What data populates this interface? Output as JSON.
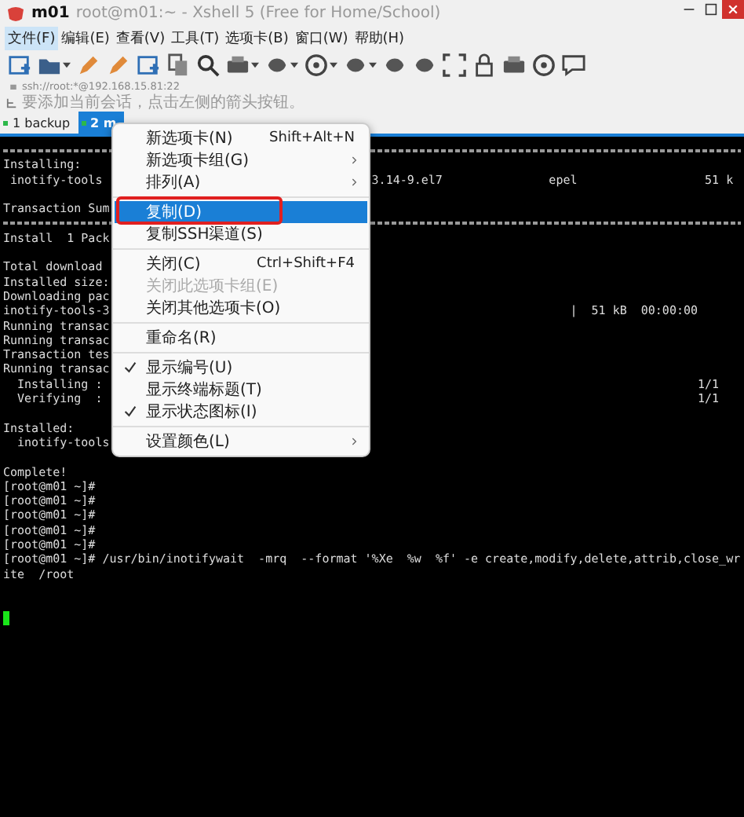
{
  "window": {
    "session": "m01",
    "title": "root@m01:~ - Xshell 5 (Free for Home/School)"
  },
  "menubar": [
    {
      "label": "文件(F)",
      "selected": true
    },
    {
      "label": "编辑(E)",
      "selected": false
    },
    {
      "label": "查看(V)",
      "selected": false
    },
    {
      "label": "工具(T)",
      "selected": false
    },
    {
      "label": "选项卡(B)",
      "selected": false
    },
    {
      "label": "窗口(W)",
      "selected": false
    },
    {
      "label": "帮助(H)",
      "selected": false
    }
  ],
  "address": "ssh://root:*@192.168.15.81:22",
  "hint": "要添加当前会话，点击左侧的箭头按钮。",
  "tabs": [
    {
      "label": "1 backup",
      "selected": false
    },
    {
      "label": "2 m",
      "selected": true
    }
  ],
  "terminal": [
    {
      "kind": "rule"
    },
    {
      "kind": "text",
      "left": "Installing:"
    },
    {
      "kind": "text",
      "left": " inotify-tools",
      "right": "3.14-9.el7               epel                  51 k"
    },
    {
      "kind": "text"
    },
    {
      "kind": "text",
      "left": "Transaction Sum"
    },
    {
      "kind": "rule"
    },
    {
      "kind": "text",
      "left": "Install  1 Pack"
    },
    {
      "kind": "text"
    },
    {
      "kind": "text",
      "left": "Total download "
    },
    {
      "kind": "text",
      "left": "Installed size:"
    },
    {
      "kind": "text",
      "left": "Downloading pac"
    },
    {
      "kind": "text",
      "left": "inotify-tools-3",
      "right": "                            |  51 kB  00:00:00"
    },
    {
      "kind": "text",
      "left": "Running transac"
    },
    {
      "kind": "text",
      "left": "Running transac"
    },
    {
      "kind": "text",
      "left": "Transaction tes"
    },
    {
      "kind": "text",
      "left": "Running transac"
    },
    {
      "kind": "text",
      "left": "  Installing :",
      "right": "                                              1/1"
    },
    {
      "kind": "text",
      "left": "  Verifying  :",
      "right": "                                              1/1"
    },
    {
      "kind": "text"
    },
    {
      "kind": "text",
      "left": "Installed:"
    },
    {
      "kind": "text",
      "left": "  inotify-tools"
    },
    {
      "kind": "text"
    },
    {
      "kind": "text",
      "left": "Complete!"
    },
    {
      "kind": "text",
      "left": "[root@m01 ~]#"
    },
    {
      "kind": "text",
      "left": "[root@m01 ~]#"
    },
    {
      "kind": "text",
      "left": "[root@m01 ~]#"
    },
    {
      "kind": "text",
      "left": "[root@m01 ~]#"
    },
    {
      "kind": "text",
      "left": "[root@m01 ~]#"
    },
    {
      "kind": "text",
      "left": "[root@m01 ~]# /usr/bin/inotifywait  -mrq  --format '%Xe  %w  %f' -e create,modify,delete,attrib,close_wr"
    },
    {
      "kind": "text",
      "left": "ite  /root"
    },
    {
      "kind": "text"
    },
    {
      "kind": "text"
    },
    {
      "kind": "cursor"
    }
  ],
  "context_menu": [
    {
      "kind": "item",
      "label": "新选项卡(N)",
      "shortcut": "Shift+Alt+N",
      "submenu": false,
      "checked": false,
      "disabled": false,
      "selected": false
    },
    {
      "kind": "item",
      "label": "新选项卡组(G)",
      "submenu": true,
      "checked": false,
      "disabled": false,
      "selected": false
    },
    {
      "kind": "item",
      "label": "排列(A)",
      "submenu": true,
      "checked": false,
      "disabled": false,
      "selected": false
    },
    {
      "kind": "separator"
    },
    {
      "kind": "item",
      "label": "复制(D)",
      "submenu": false,
      "checked": false,
      "disabled": false,
      "selected": true,
      "annotated": true
    },
    {
      "kind": "item",
      "label": "复制SSH渠道(S)",
      "submenu": false,
      "checked": false,
      "disabled": false,
      "selected": false
    },
    {
      "kind": "separator"
    },
    {
      "kind": "item",
      "label": "关闭(C)",
      "shortcut": "Ctrl+Shift+F4",
      "submenu": false,
      "checked": false,
      "disabled": false,
      "selected": false
    },
    {
      "kind": "item",
      "label": "关闭此选项卡组(E)",
      "submenu": false,
      "checked": false,
      "disabled": true,
      "selected": false
    },
    {
      "kind": "item",
      "label": "关闭其他选项卡(O)",
      "submenu": false,
      "checked": false,
      "disabled": false,
      "selected": false
    },
    {
      "kind": "separator"
    },
    {
      "kind": "item",
      "label": "重命名(R)",
      "submenu": false,
      "checked": false,
      "disabled": false,
      "selected": false
    },
    {
      "kind": "separator"
    },
    {
      "kind": "item",
      "label": "显示编号(U)",
      "submenu": false,
      "checked": true,
      "disabled": false,
      "selected": false
    },
    {
      "kind": "item",
      "label": "显示终端标题(T)",
      "submenu": false,
      "checked": false,
      "disabled": false,
      "selected": false
    },
    {
      "kind": "item",
      "label": "显示状态图标(I)",
      "submenu": false,
      "checked": true,
      "disabled": false,
      "selected": false
    },
    {
      "kind": "separator"
    },
    {
      "kind": "item",
      "label": "设置颜色(L)",
      "submenu": true,
      "checked": false,
      "disabled": false,
      "selected": false
    }
  ]
}
